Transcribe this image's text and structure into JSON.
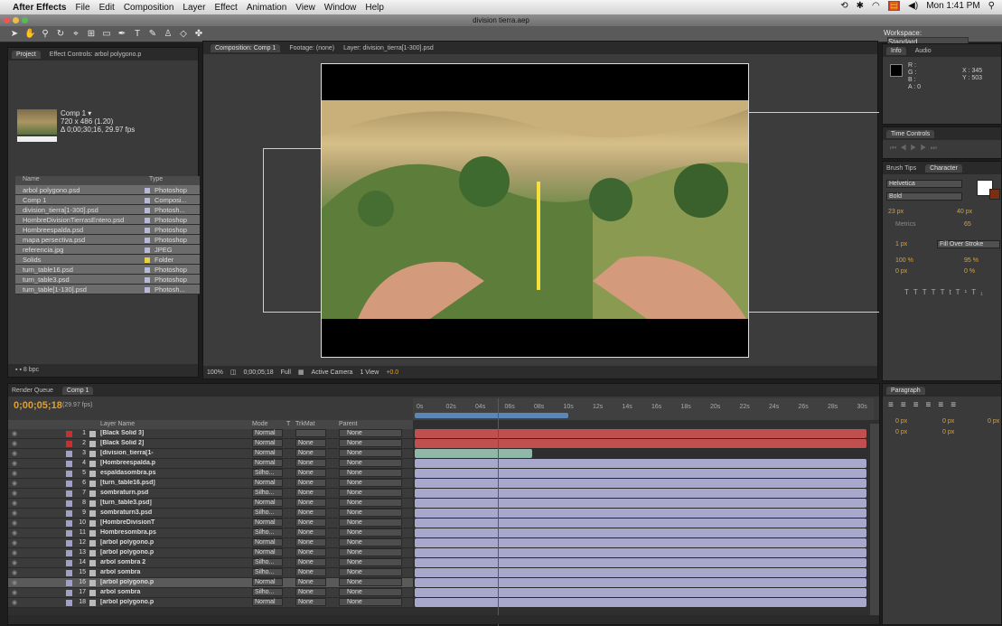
{
  "menubar": {
    "app": "After Effects",
    "items": [
      "File",
      "Edit",
      "Composition",
      "Layer",
      "Effect",
      "Animation",
      "View",
      "Window",
      "Help"
    ],
    "clock": "Mon 1:41 PM"
  },
  "titlebar": {
    "title": "division tierra.aep"
  },
  "toolbar": {
    "workspace_label": "Workspace:",
    "workspace_value": "Standard"
  },
  "project": {
    "tabs": [
      "Project",
      "Effect Controls: arbol polygono.p"
    ],
    "comp_name": "Comp 1 ▾",
    "comp_size": "720 x 486 (1.20)",
    "comp_duration": "Δ 0;00;30;16, 29.97 fps",
    "col_name": "Name",
    "col_type": "Type",
    "items": [
      {
        "name": "arbol polygono.psd",
        "type": "Photoshop",
        "color": "#b8b8d8"
      },
      {
        "name": "Comp 1",
        "type": "Composi...",
        "color": "#b8b8d8"
      },
      {
        "name": "division_tierra[1-300].psd",
        "type": "Photosh...",
        "color": "#b8b8d8"
      },
      {
        "name": "HombreDivisionTierrasEntero.psd",
        "type": "Photoshop",
        "color": "#b8b8d8"
      },
      {
        "name": "Hombreespalda.psd",
        "type": "Photoshop",
        "color": "#b8b8d8"
      },
      {
        "name": "mapa persectiva.psd",
        "type": "Photoshop",
        "color": "#b8b8d8"
      },
      {
        "name": "referencia.jpg",
        "type": "JPEG",
        "color": "#b8b8d8"
      },
      {
        "name": "Solids",
        "type": "Folder",
        "color": "#e8d040"
      },
      {
        "name": "turn_table16.psd",
        "type": "Photoshop",
        "color": "#b8b8d8"
      },
      {
        "name": "turn_table3.psd",
        "type": "Photoshop",
        "color": "#b8b8d8"
      },
      {
        "name": "turn_table[1-130].psd",
        "type": "Photosh...",
        "color": "#b8b8d8"
      }
    ],
    "footer_bpc": "8 bpc"
  },
  "viewer": {
    "tabs": [
      "Composition: Comp 1",
      "Footage: (none)",
      "Layer: division_tierra[1-300].psd"
    ],
    "zoom": "100%",
    "timecode": "0;00;05;18",
    "resolution": "Full",
    "camera": "Active Camera",
    "view": "1 View",
    "exposure": "+0.0"
  },
  "info": {
    "tabs": [
      "Info",
      "Audio"
    ],
    "r": "R :",
    "g": "G :",
    "b": "B :",
    "a": "A : 0",
    "x": "X : 345",
    "y": "Y : 503"
  },
  "timectl": {
    "title": "Time Controls"
  },
  "character": {
    "tabs": [
      "Brush Tips",
      "Character"
    ],
    "font": "Helvetica",
    "style": "Bold",
    "size": "23 px",
    "leading": "40 px",
    "kerning": "Metrics",
    "tracking": "65",
    "stroke": "1 px",
    "stroke_mode": "Fill Over Stroke",
    "vscale": "100 %",
    "hscale": "95 %",
    "baseline": "0 px",
    "tsume": "0 %"
  },
  "paragraph": {
    "title": "Paragraph",
    "indent_values": [
      "0 px",
      "0 px",
      "0 px",
      "0 px",
      "0 px"
    ]
  },
  "timeline": {
    "tabs": [
      "Render Queue",
      "Comp 1"
    ],
    "timecode": "0;00;05;18",
    "fps": "(29.97 fps)",
    "col_layer": "Layer Name",
    "col_mode": "Mode",
    "col_t": "T",
    "col_trkmat": "TrkMat",
    "col_parent": "Parent",
    "ruler": [
      "0s",
      "02s",
      "04s",
      "06s",
      "08s",
      "10s",
      "12s",
      "14s",
      "16s",
      "18s",
      "20s",
      "22s",
      "24s",
      "26s",
      "28s",
      "30s"
    ],
    "layers": [
      {
        "n": "1",
        "name": "[Black Solid 3]",
        "mode": "Normal",
        "trk": "",
        "parent": "None",
        "color": "#c83030",
        "bar": "#c05050",
        "barw": 500
      },
      {
        "n": "2",
        "name": "[Black Solid 2]",
        "mode": "Normal",
        "trk": "None",
        "parent": "None",
        "color": "#c83030",
        "bar": "#c05050",
        "barw": 500
      },
      {
        "n": "3",
        "name": "[division_tierra[1-",
        "mode": "Normal",
        "trk": "None",
        "parent": "None",
        "color": "#a0a0c8",
        "bar": "#8fb8a8",
        "barw": 130
      },
      {
        "n": "4",
        "name": "[Hombreespalda.p",
        "mode": "Normal",
        "trk": "None",
        "parent": "None",
        "color": "#a0a0c8",
        "bar": "#a8a8cc",
        "barw": 500
      },
      {
        "n": "5",
        "name": "espaldasombra.ps",
        "mode": "Silho...",
        "trk": "None",
        "parent": "None",
        "color": "#a0a0c8",
        "bar": "#a8a8cc",
        "barw": 500
      },
      {
        "n": "6",
        "name": "[turn_table16.psd]",
        "mode": "Normal",
        "trk": "None",
        "parent": "None",
        "color": "#a0a0c8",
        "bar": "#a8a8cc",
        "barw": 500
      },
      {
        "n": "7",
        "name": "sombraturn.psd",
        "mode": "Silho...",
        "trk": "None",
        "parent": "None",
        "color": "#a0a0c8",
        "bar": "#a8a8cc",
        "barw": 500
      },
      {
        "n": "8",
        "name": "[turn_table3.psd]",
        "mode": "Normal",
        "trk": "None",
        "parent": "None",
        "color": "#a0a0c8",
        "bar": "#a8a8cc",
        "barw": 500
      },
      {
        "n": "9",
        "name": "sombraturn3.psd",
        "mode": "Silho...",
        "trk": "None",
        "parent": "None",
        "color": "#a0a0c8",
        "bar": "#a8a8cc",
        "barw": 500
      },
      {
        "n": "10",
        "name": "[HombreDivisionT",
        "mode": "Normal",
        "trk": "None",
        "parent": "None",
        "color": "#a0a0c8",
        "bar": "#a8a8cc",
        "barw": 500
      },
      {
        "n": "11",
        "name": "Hombresombra.ps",
        "mode": "Silho...",
        "trk": "None",
        "parent": "None",
        "color": "#a0a0c8",
        "bar": "#a8a8cc",
        "barw": 500
      },
      {
        "n": "12",
        "name": "[arbol polygono.p",
        "mode": "Normal",
        "trk": "None",
        "parent": "None",
        "color": "#a0a0c8",
        "bar": "#a8a8cc",
        "barw": 500
      },
      {
        "n": "13",
        "name": "[arbol polygono.p",
        "mode": "Normal",
        "trk": "None",
        "parent": "None",
        "color": "#a0a0c8",
        "bar": "#a8a8cc",
        "barw": 500
      },
      {
        "n": "14",
        "name": "arbol sombra 2",
        "mode": "Silho...",
        "trk": "None",
        "parent": "None",
        "color": "#a0a0c8",
        "bar": "#a8a8cc",
        "barw": 500
      },
      {
        "n": "15",
        "name": "arbol sombra",
        "mode": "Silho...",
        "trk": "None",
        "parent": "None",
        "color": "#a0a0c8",
        "bar": "#a8a8cc",
        "barw": 500
      },
      {
        "n": "16",
        "name": "[arbol polygono.p",
        "mode": "Normal",
        "trk": "None",
        "parent": "None",
        "color": "#a0a0c8",
        "bar": "#a8a8cc",
        "barw": 500,
        "selected": true
      },
      {
        "n": "17",
        "name": "arbol sombra",
        "mode": "Silho...",
        "trk": "None",
        "parent": "None",
        "color": "#a0a0c8",
        "bar": "#a8a8cc",
        "barw": 500
      },
      {
        "n": "18",
        "name": "[arbol polygono.p",
        "mode": "Normal",
        "trk": "None",
        "parent": "None",
        "color": "#a0a0c8",
        "bar": "#a8a8cc",
        "barw": 500
      }
    ]
  }
}
